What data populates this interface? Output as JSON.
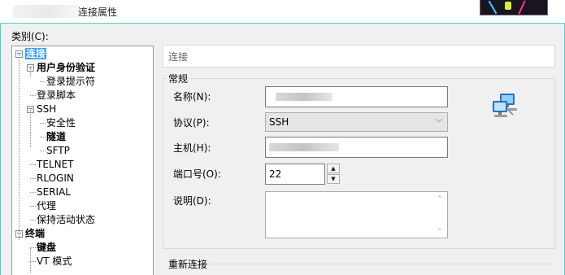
{
  "window": {
    "title": "连接属性"
  },
  "category_label": "类别(C):",
  "tree": [
    {
      "label": "连接",
      "level": 0,
      "expanded": true,
      "selected": true,
      "bold": true
    },
    {
      "label": "用户身份验证",
      "level": 1,
      "expanded": true,
      "bold": true
    },
    {
      "label": "登录提示符",
      "level": 2
    },
    {
      "label": "登录脚本",
      "level": 1
    },
    {
      "label": "SSH",
      "level": 1,
      "expanded": true
    },
    {
      "label": "安全性",
      "level": 2
    },
    {
      "label": "隧道",
      "level": 2,
      "bold": true
    },
    {
      "label": "SFTP",
      "level": 2
    },
    {
      "label": "TELNET",
      "level": 1
    },
    {
      "label": "RLOGIN",
      "level": 1
    },
    {
      "label": "SERIAL",
      "level": 1
    },
    {
      "label": "代理",
      "level": 1
    },
    {
      "label": "保持活动状态",
      "level": 1
    },
    {
      "label": "终端",
      "level": 0,
      "expanded": true,
      "bold": true
    },
    {
      "label": "键盘",
      "level": 1,
      "bold": true
    },
    {
      "label": "VT 模式",
      "level": 1
    }
  ],
  "panel": {
    "header": "连接",
    "group_general": "常规",
    "name_label": "名称(N):",
    "protocol_label": "协议(P):",
    "protocol_value": "SSH",
    "host_label": "主机(H):",
    "port_label": "端口号(O):",
    "port_value": "22",
    "description_label": "说明(D):",
    "group_reconnect": "重新连接"
  },
  "icons": {
    "network": "network-computers-icon",
    "expander": "tree-expander-minus-icon",
    "dropdown": "chevron-down-icon",
    "spin_up": "spin-up-icon",
    "spin_down": "spin-down-icon"
  },
  "colors": {
    "selection": "#3399ff",
    "frame_accent": "#4fd0c8",
    "dialog_bg": "#f0f0f0"
  }
}
